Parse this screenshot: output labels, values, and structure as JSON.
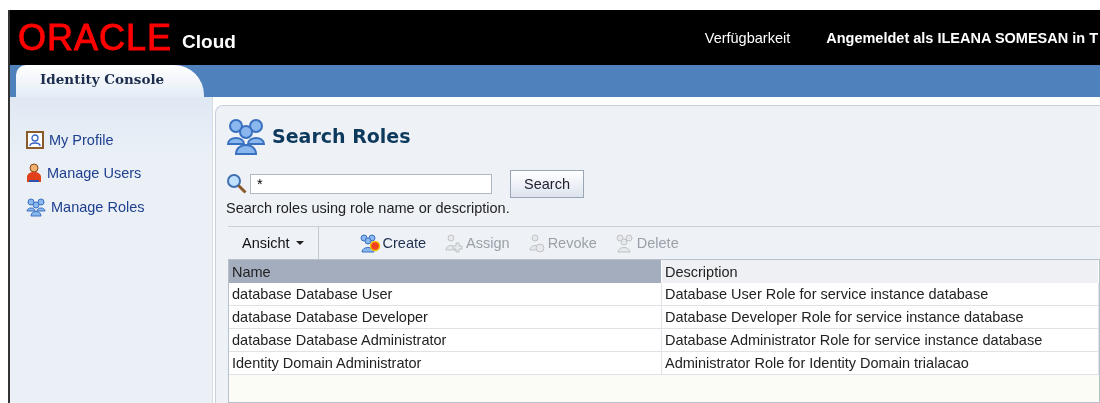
{
  "header": {
    "logo": "ORACLE",
    "product": "Cloud",
    "links": [
      {
        "label": "Verfügbarkeit",
        "bold": false
      },
      {
        "label": "Angemeldet als ILEANA SOMESAN in T",
        "bold": true
      }
    ]
  },
  "tabs": [
    {
      "label": "Identity Console",
      "selected": true
    }
  ],
  "sidebar": {
    "items": [
      {
        "label": "My Profile",
        "kind": "profile"
      },
      {
        "label": "Manage Users",
        "kind": "user"
      },
      {
        "label": "Manage Roles",
        "kind": "roles"
      }
    ]
  },
  "page": {
    "title": "Search Roles",
    "search": {
      "value": "*",
      "button": "Search",
      "hint": "Search roles using role name or description."
    },
    "toolbar": {
      "view": "Ansicht",
      "actions": [
        {
          "label": "Create",
          "kind": "create",
          "disabled": false
        },
        {
          "label": "Assign",
          "kind": "assign",
          "disabled": true
        },
        {
          "label": "Revoke",
          "kind": "revoke",
          "disabled": true
        },
        {
          "label": "Delete",
          "kind": "delete",
          "disabled": true
        }
      ]
    },
    "table": {
      "columns": [
        "Name",
        "Description"
      ],
      "rows": [
        {
          "cells": [
            "database Database User",
            "Database User Role for service instance database"
          ]
        },
        {
          "cells": [
            "database Database Developer",
            "Database Developer Role for service instance database"
          ]
        },
        {
          "cells": [
            "database Database Administrator",
            "Database Administrator Role for service instance database"
          ]
        },
        {
          "cells": [
            "Identity Domain Administrator",
            "Administrator Role for Identity Domain trialacao"
          ]
        }
      ]
    }
  }
}
